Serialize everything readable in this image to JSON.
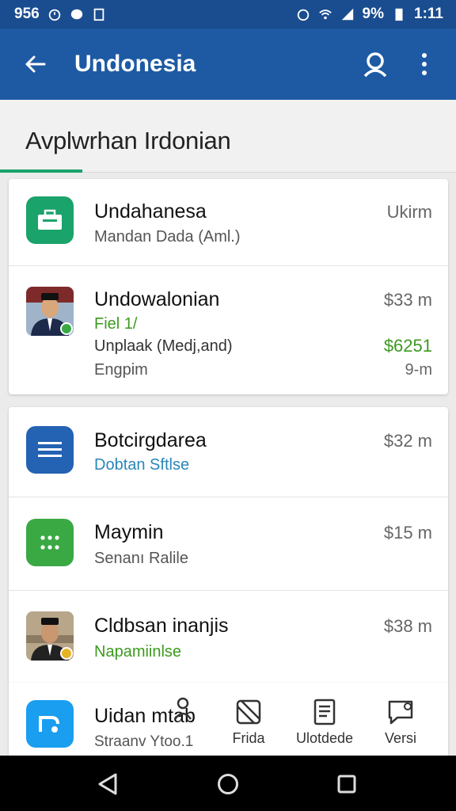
{
  "status_bar": {
    "left_text": "956",
    "battery_text": "9%",
    "time": "1:11"
  },
  "app_bar": {
    "title": "Undonesia"
  },
  "section": {
    "title": "Avplwrhan Irdonian"
  },
  "card1": {
    "rows": [
      {
        "title": "Undahanesa",
        "subtitle": "Mandan Dada (Aml.)",
        "right": "Ukirm",
        "icon": "briefcase-icon",
        "icon_color": "#1aa36b"
      },
      {
        "title": "Undowalonian",
        "subtitle_green": "Fiel 1/",
        "subtitle": "Unplaak (Medj,and)",
        "subtitle2": "Engpim",
        "right": "$33 m",
        "right_green": "$6251",
        "right2": "9-m",
        "icon": "avatar"
      }
    ]
  },
  "card2": {
    "rows": [
      {
        "title": "Botcirgdarea",
        "subtitle": "Dobtan Sftlse",
        "right": "$32 m",
        "icon": "menu-icon",
        "icon_color": "#2462b3"
      },
      {
        "title": "Maymin",
        "subtitle": "Senanı Ralile",
        "right": "$15 m",
        "icon": "dots-icon",
        "icon_color": "#3aa944"
      },
      {
        "title": "Cldbsan inanjis",
        "subtitle": "Napamiinlse",
        "right": "$38 m",
        "icon": "avatar"
      },
      {
        "title": "Uidan mtab",
        "subtitle": "Straanv  Ytoo.1",
        "icon": "app-icon",
        "icon_color": "#1a9ef0"
      }
    ]
  },
  "bottom_bar": {
    "items": [
      {
        "label": "Frida",
        "icon": "striped-square-icon"
      },
      {
        "label": "Ulotdede",
        "icon": "document-icon"
      },
      {
        "label": "Versi",
        "icon": "chat-icon"
      }
    ]
  },
  "colors": {
    "primary": "#1d5aa3",
    "status": "#1a4d8f",
    "accent": "#1aa36b"
  }
}
